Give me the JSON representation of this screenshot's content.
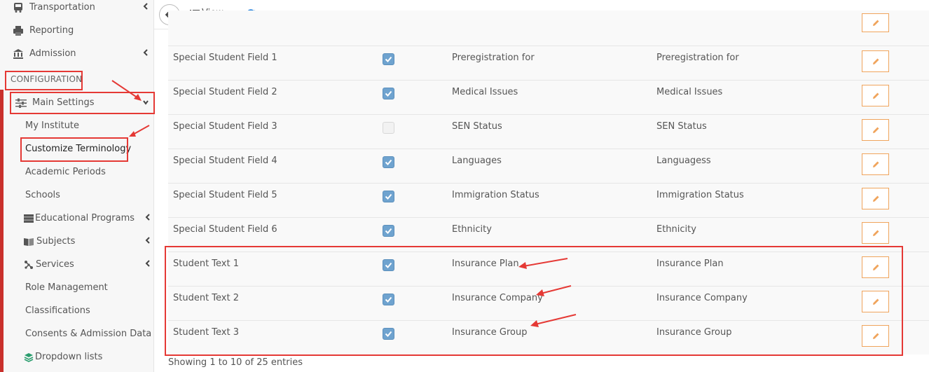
{
  "sidebar": {
    "top_items": [
      {
        "label": "Transportation",
        "icon": "bus-icon"
      },
      {
        "label": "Reporting",
        "icon": "printer-icon"
      },
      {
        "label": "Admission",
        "icon": "bank-icon"
      }
    ],
    "section_label": "CONFIGURATION",
    "main_settings_label": "Main Settings",
    "sub_items": [
      {
        "label": "My Institute"
      },
      {
        "label": "Customize Terminology"
      },
      {
        "label": "Academic Periods"
      },
      {
        "label": "Schools"
      },
      {
        "label": "Educational Programs",
        "icon": "server-icon"
      },
      {
        "label": "Subjects",
        "icon": "book-icon"
      },
      {
        "label": "Services",
        "icon": "network-icon"
      },
      {
        "label": "Role Management"
      },
      {
        "label": "Classifications"
      },
      {
        "label": "Consents & Admission Data"
      },
      {
        "label": "Dropdown lists",
        "icon": "layers-icon"
      }
    ]
  },
  "toolbar": {
    "view_label": "View"
  },
  "table": {
    "rows": [
      {
        "name": "Special Student Field 1",
        "checked": true,
        "default": "Preregistration for",
        "custom": "Preregistration for"
      },
      {
        "name": "Special Student Field 2",
        "checked": true,
        "default": "Medical Issues",
        "custom": "Medical Issues"
      },
      {
        "name": "Special Student Field 3",
        "checked": false,
        "default": "SEN Status",
        "custom": "SEN Status"
      },
      {
        "name": "Special Student Field 4",
        "checked": true,
        "default": "Languages",
        "custom": "Languagess"
      },
      {
        "name": "Special Student Field 5",
        "checked": true,
        "default": "Immigration Status",
        "custom": "Immigration Status"
      },
      {
        "name": "Special Student Field 6",
        "checked": true,
        "default": "Ethnicity",
        "custom": "Ethnicity"
      },
      {
        "name": "Student Text 1",
        "checked": true,
        "default": "Insurance Plan",
        "custom": "Insurance Plan"
      },
      {
        "name": "Student Text 2",
        "checked": true,
        "default": "Insurance Company",
        "custom": "Insurance Company"
      },
      {
        "name": "Student Text 3",
        "checked": true,
        "default": "Insurance Group",
        "custom": "Insurance Group"
      }
    ]
  },
  "footer": {
    "entries_text": "Showing 1 to 10 of 25 entries"
  },
  "colors": {
    "highlight": "#e53935",
    "checkbox": "#6fa3cf",
    "edit_border": "#f0a45c",
    "refresh": "#2e86de"
  }
}
